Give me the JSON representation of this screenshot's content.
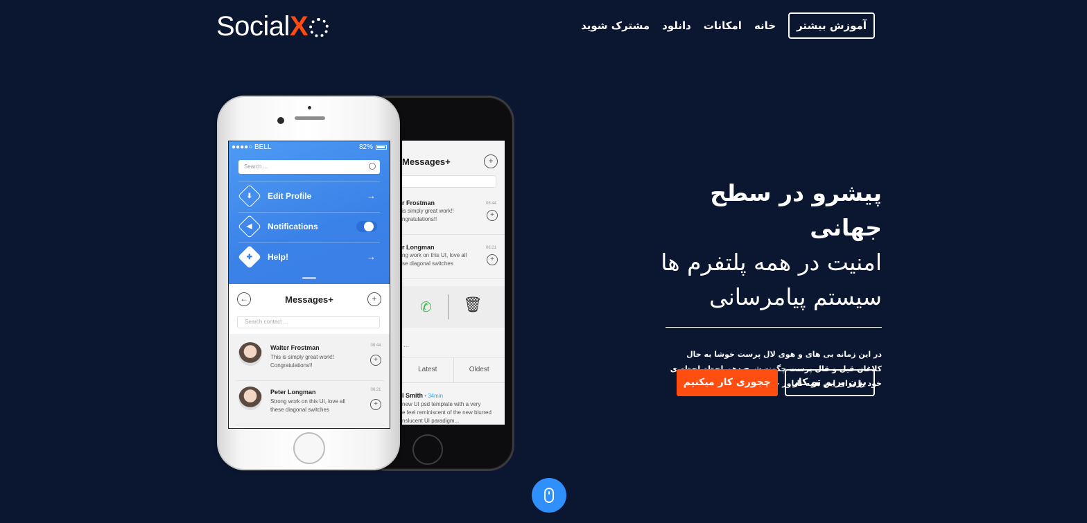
{
  "header": {
    "logo_text": "Social",
    "logo_x": "X",
    "nav": {
      "learn_more": "آموزش بیشتر",
      "home": "خانه",
      "features": "امکانات",
      "download": "دانلود",
      "subscribe": "مشترک شوید"
    }
  },
  "front_phone": {
    "status": {
      "carrier": "●●●●○ BELL",
      "battery": "82%"
    },
    "search_placeholder": "Search ...",
    "menu": [
      {
        "label": "Edit Profile",
        "icon": "⬇"
      },
      {
        "label": "Notifications",
        "icon": "◀"
      },
      {
        "label": "Help!",
        "icon": "✚"
      }
    ],
    "messages_title": "Messages+",
    "contact_search_placeholder": "Search contact ...",
    "messages": [
      {
        "name": "Walter Frostman",
        "time": "08:44",
        "line1": "This is simply great work!!",
        "line2": "Congratulations!!"
      },
      {
        "name": "Peter Longman",
        "time": "06:21",
        "line1": "Strong work on this UI, love all",
        "line2": "these diagonal switches"
      }
    ]
  },
  "back_phone": {
    "messages_title": "Messages+",
    "messages": [
      {
        "name": "r Frostman",
        "time": "08:44",
        "line1": "is simply great work!!",
        "line2": "ngratulations!!"
      },
      {
        "name": "r Longman",
        "time": "06:21",
        "line1": "ng work on this UI, love all",
        "line2": "se diagonal switches"
      }
    ],
    "ellipsis": "...",
    "tabs": {
      "latest": "Latest",
      "oldest": "Oldest"
    },
    "post": {
      "name": "l Smith",
      "ago": "• 34min",
      "line1": "new UI psd template with a very",
      "line2": "e feel reminiscent of the new blurred",
      "line3": "nslucent UI paradigm..."
    }
  },
  "hero": {
    "line1": "پیشرو در سطح جهانی",
    "line2": "امنیت در همه پلتفرم ها",
    "line3": "سیستم پیامرسانی",
    "description": "در این زمانه بی های و هوی لال پرست خوشا به حال کلاغان قیل و قال پرست چگونه شرح دهم لحظه لحظه ی خود را برای این همه ناباور خیال پرست",
    "btn_start": "بزن بریم تو کار",
    "btn_how": "چجوری کار میکنیم"
  },
  "colors": {
    "background": "#0b1731",
    "accent": "#ff4e10",
    "scroll_button": "#2f8ffb"
  },
  "icons": {
    "scroll": "mouse-icon"
  }
}
